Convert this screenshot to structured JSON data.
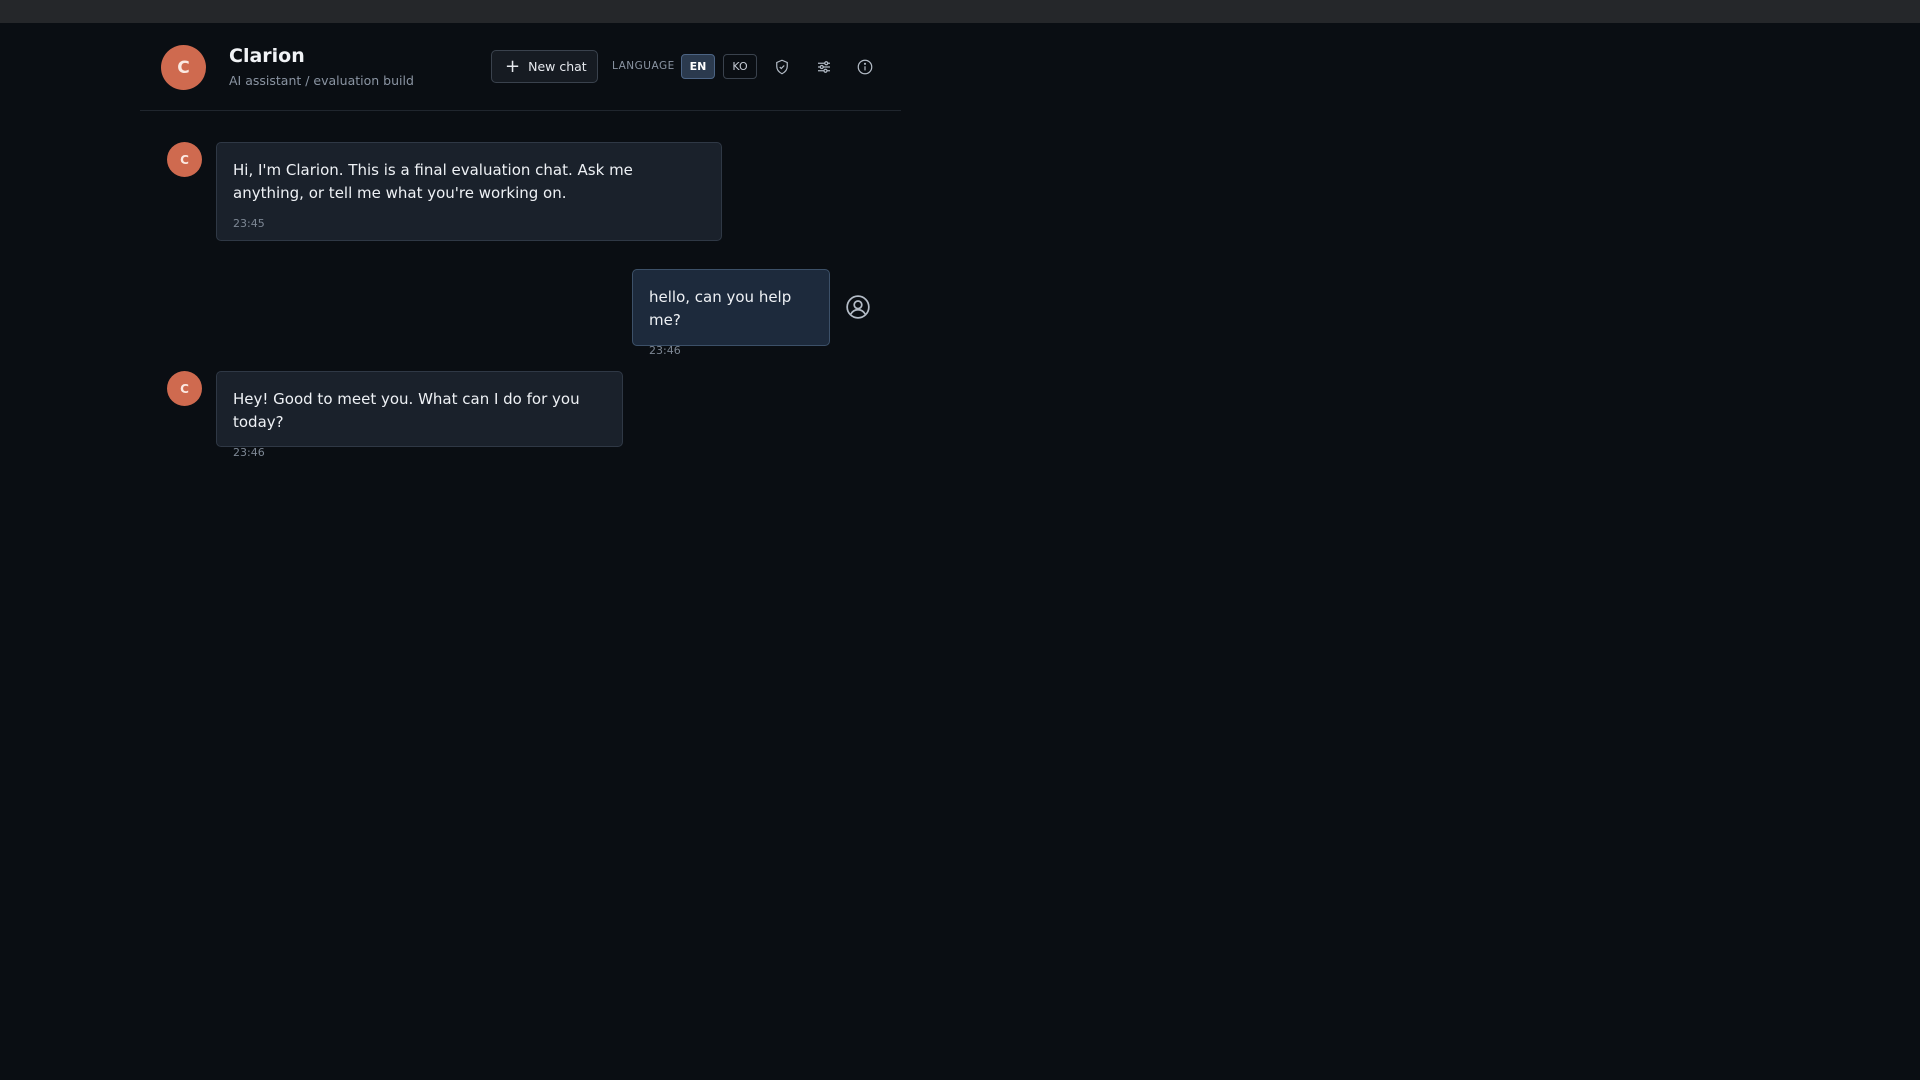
{
  "header": {
    "avatar_letter": "C",
    "title": "Clarion",
    "subtitle": "AI assistant / evaluation build",
    "new_chat_label": "New chat",
    "language_label": "LANGUAGE",
    "languages": [
      {
        "code": "EN",
        "selected": true
      },
      {
        "code": "KO",
        "selected": false
      }
    ],
    "icons": [
      "shield-icon",
      "sliders-icon",
      "info-icon"
    ]
  },
  "messages": [
    {
      "role": "assistant",
      "avatar_letter": "C",
      "text": "Hi, I'm Clarion. This is a final evaluation chat. Ask me anything, or tell me what you're working on.",
      "time": "23:45"
    },
    {
      "role": "user",
      "text": "hello, can you help me?",
      "time": "23:46"
    },
    {
      "role": "assistant",
      "avatar_letter": "C",
      "text": "Hey! Good to meet you. What can I do for you today?",
      "time": "23:46"
    }
  ],
  "colors": {
    "background": "#0a0e13",
    "accent_avatar": "#cf6a4f",
    "bot_bubble": "#1a212b",
    "user_bubble": "#1d2a3c",
    "selected_lang": "#2b3a4e"
  }
}
